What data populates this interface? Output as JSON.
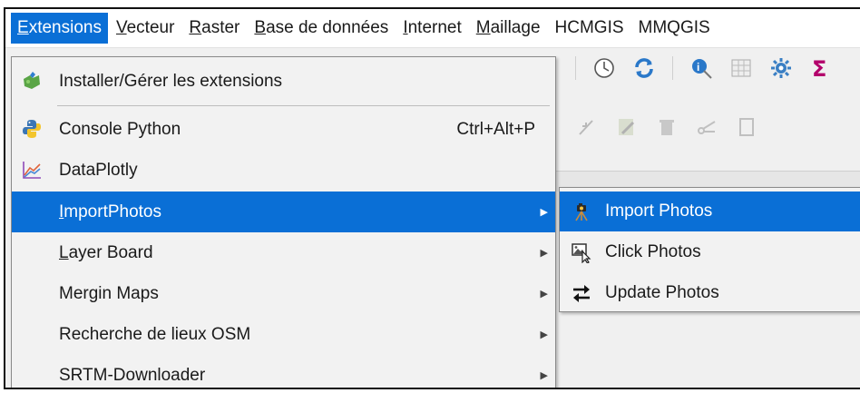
{
  "menubar": {
    "items": [
      {
        "label": "Extensions",
        "underline": "E",
        "rest": "xtensions"
      },
      {
        "label": "Vecteur",
        "underline": "V",
        "rest": "ecteur"
      },
      {
        "label": "Raster",
        "underline": "R",
        "rest": "aster"
      },
      {
        "label": "Base de données",
        "underline": "B",
        "rest": "ase de données"
      },
      {
        "label": "Internet",
        "underline": "I",
        "rest": "nternet"
      },
      {
        "label": "Maillage",
        "underline": "M",
        "rest": "aillage"
      },
      {
        "label": "HCMGIS",
        "underline": "",
        "rest": "HCMGIS"
      },
      {
        "label": "MMQGIS",
        "underline": "",
        "rest": "MMQGIS"
      }
    ]
  },
  "extensions_menu": {
    "items": [
      {
        "label": "Installer/Gérer les extensions",
        "icon": "puzzle-icon"
      },
      {
        "label": "Console Python",
        "shortcut": "Ctrl+Alt+P",
        "icon": "python-icon"
      },
      {
        "label": "DataPlotly",
        "icon": "chart-icon"
      },
      {
        "label_u": "I",
        "label_rest": "mportPhotos",
        "has_submenu": true
      },
      {
        "label_u": "L",
        "label_rest": "ayer Board",
        "has_submenu": true
      },
      {
        "label_u": "",
        "label_rest": "Mergin Maps",
        "has_submenu": true
      },
      {
        "label_u": "",
        "label_rest": "Recherche de lieux OSM",
        "has_submenu": true
      },
      {
        "label_u": "",
        "label_rest": "SRTM-Downloader",
        "has_submenu": true
      }
    ]
  },
  "importphotos_submenu": {
    "items": [
      {
        "label": "Import Photos",
        "icon": "camera-tripod-icon"
      },
      {
        "label": "Click Photos",
        "icon": "photo-cursor-icon"
      },
      {
        "label": "Update Photos",
        "icon": "swap-arrows-icon"
      }
    ]
  },
  "colors": {
    "highlight": "#0a6fd6",
    "menu_bg": "#f2f2f2"
  }
}
